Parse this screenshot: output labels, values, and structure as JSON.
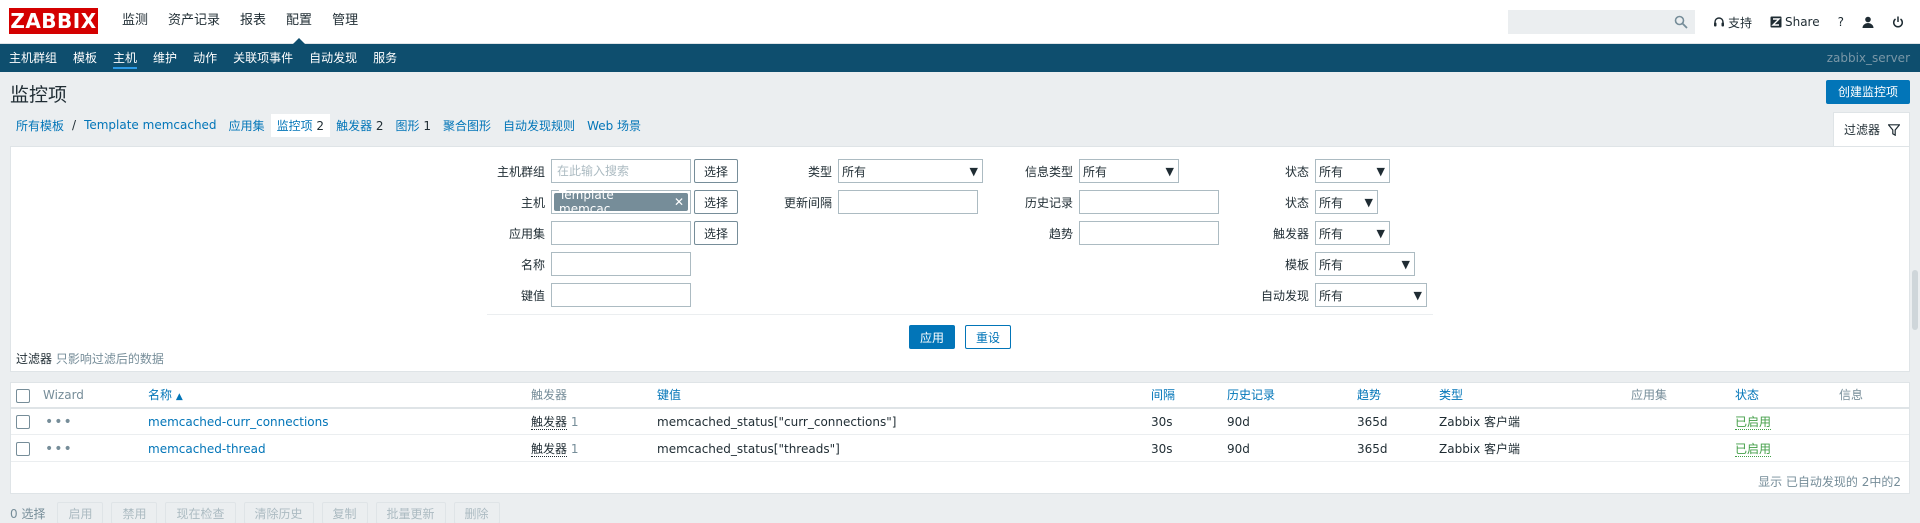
{
  "app": {
    "logo": "ZABBIX",
    "server": "zabbix_server"
  },
  "topnav": [
    {
      "label": "监测",
      "active": false
    },
    {
      "label": "资产记录",
      "active": false
    },
    {
      "label": "报表",
      "active": false
    },
    {
      "label": "配置",
      "active": true
    },
    {
      "label": "管理",
      "active": false
    }
  ],
  "topright": {
    "search_value": "",
    "support": "支持",
    "share": "Share",
    "help": "?",
    "user_icon": "user-icon",
    "logout_icon": "power-icon"
  },
  "subnav": [
    {
      "label": "主机群组",
      "active": false
    },
    {
      "label": "模板",
      "active": false
    },
    {
      "label": "主机",
      "active": true
    },
    {
      "label": "维护",
      "active": false
    },
    {
      "label": "动作",
      "active": false
    },
    {
      "label": "关联项事件",
      "active": false
    },
    {
      "label": "自动发现",
      "active": false
    },
    {
      "label": "服务",
      "active": false
    }
  ],
  "page": {
    "title": "监控项",
    "create_button": "创建监控项"
  },
  "breadcrumb": {
    "all_templates": "所有模板",
    "separator": "/",
    "template": "Template memcached",
    "links": [
      {
        "label": "应用集",
        "count": ""
      },
      {
        "label": "监控项",
        "count": "2",
        "current": true
      },
      {
        "label": "触发器",
        "count": "2"
      },
      {
        "label": "图形",
        "count": "1"
      },
      {
        "label": "聚合图形",
        "count": ""
      },
      {
        "label": "自动发现规则",
        "count": ""
      },
      {
        "label": "Web 场景",
        "count": ""
      }
    ],
    "filter_tab": "过滤器"
  },
  "filter": {
    "host_group": {
      "label": "主机群组",
      "placeholder": "在此输入搜索",
      "button": "选择"
    },
    "host": {
      "label": "主机",
      "chip": "Template memcac...",
      "button": "选择"
    },
    "application": {
      "label": "应用集",
      "value": "",
      "button": "选择"
    },
    "name": {
      "label": "名称",
      "value": ""
    },
    "key": {
      "label": "键值",
      "value": ""
    },
    "type": {
      "label": "类型",
      "value": "所有"
    },
    "update_interval": {
      "label": "更新间隔",
      "value": ""
    },
    "info_type": {
      "label": "信息类型",
      "value": "所有"
    },
    "history": {
      "label": "历史记录",
      "value": ""
    },
    "trends": {
      "label": "趋势",
      "value": ""
    },
    "state": {
      "label": "状态",
      "value": "所有"
    },
    "status": {
      "label": "状态",
      "value": "所有"
    },
    "triggers": {
      "label": "触发器",
      "value": "所有"
    },
    "template": {
      "label": "模板",
      "value": "所有"
    },
    "discovered": {
      "label": "自动发现",
      "value": "所有"
    },
    "apply": "应用",
    "reset": "重设",
    "note_title": "过滤器",
    "note_text": "只影响过滤后的数据"
  },
  "table": {
    "headers": {
      "wizard": "Wizard",
      "name": "名称",
      "sort_indicator": "▲",
      "triggers": "触发器",
      "key": "键值",
      "interval": "间隔",
      "history": "历史记录",
      "trends": "趋势",
      "type": "类型",
      "applications": "应用集",
      "status": "状态",
      "info": "信息"
    },
    "rows": [
      {
        "wizard": "•••",
        "name": "memcached-curr_connections",
        "trigger_label": "触发器",
        "trigger_count": "1",
        "key": "memcached_status[\"curr_connections\"]",
        "interval": "30s",
        "history": "90d",
        "trends": "365d",
        "type": "Zabbix 客户端",
        "applications": "",
        "status": "已启用",
        "info": ""
      },
      {
        "wizard": "•••",
        "name": "memcached-thread",
        "trigger_label": "触发器",
        "trigger_count": "1",
        "key": "memcached_status[\"threads\"]",
        "interval": "30s",
        "history": "90d",
        "trends": "365d",
        "type": "Zabbix 客户端",
        "applications": "",
        "status": "已启用",
        "info": ""
      }
    ],
    "footer": "显示 已自动发现的 2中的2"
  },
  "actions": {
    "selected": "0 选择",
    "buttons": [
      "启用",
      "禁用",
      "现在检查",
      "清除历史",
      "复制",
      "批量更新",
      "删除"
    ]
  }
}
